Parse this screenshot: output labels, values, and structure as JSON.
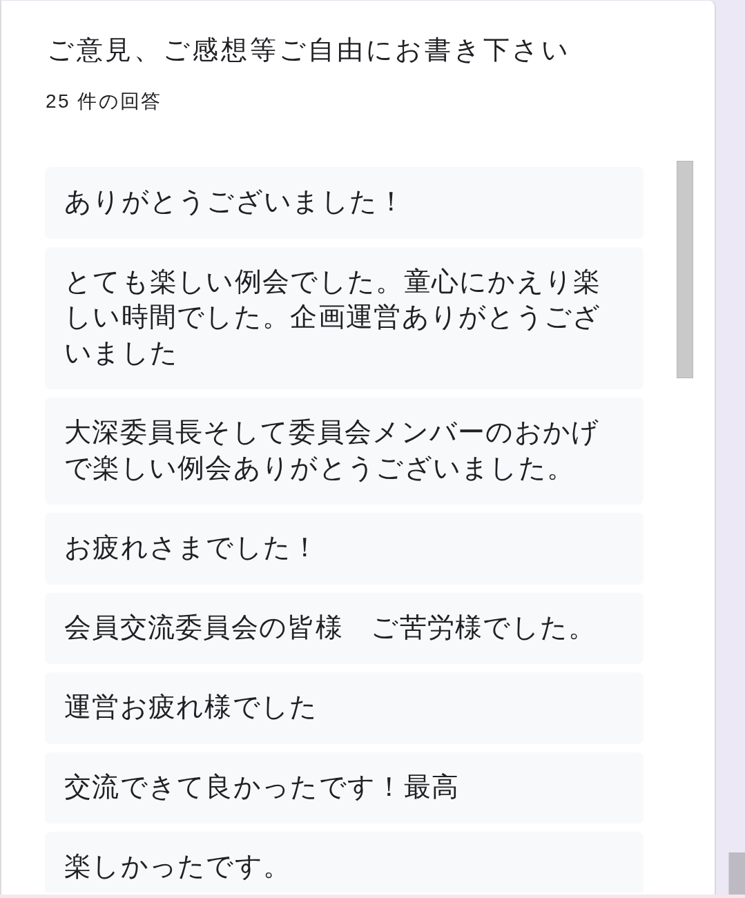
{
  "question": {
    "title": "ご意見、ご感想等ご自由にお書き下さい",
    "response_count": "25 件の回答"
  },
  "responses": [
    "ありがとうございました！",
    "とても楽しい例会でした。童心にかえり楽しい時間でした。企画運営ありがとうございました",
    "大深委員長そして委員会メンバーのおかげで楽しい例会ありがとうございました。",
    "お疲れさまでした！",
    "会員交流委員会の皆様　ご苦労様でした。",
    "運営お疲れ様でした",
    "交流できて良かったです！最高",
    "楽しかったです。"
  ]
}
